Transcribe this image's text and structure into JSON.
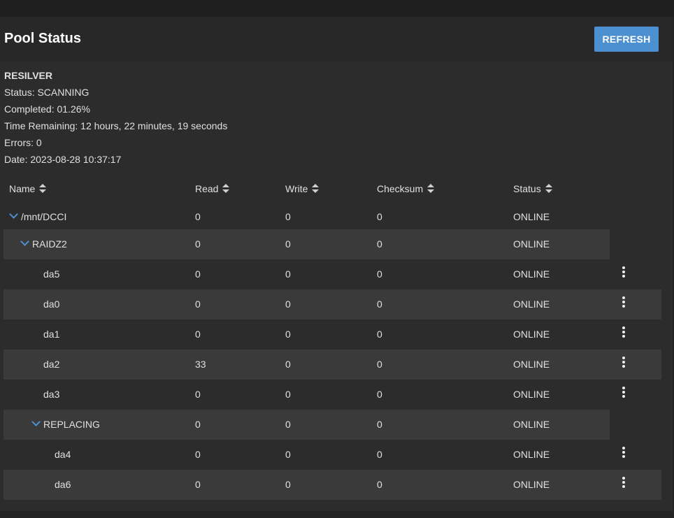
{
  "header": {
    "title": "Pool Status",
    "refresh_label": "REFRESH"
  },
  "resilver": {
    "heading": "RESILVER",
    "status": "Status: SCANNING",
    "completed": "Completed: 01.26%",
    "time_remaining": "Time Remaining: 12 hours, 22 minutes, 19 seconds",
    "errors": "Errors: 0",
    "date": "Date: 2023-08-28 10:37:17"
  },
  "table": {
    "columns": [
      "Name",
      "Read",
      "Write",
      "Checksum",
      "Status"
    ],
    "rows": [
      {
        "name": "/mnt/DCCI",
        "read": "0",
        "write": "0",
        "checksum": "0",
        "status": "ONLINE"
      },
      {
        "name": "RAIDZ2",
        "read": "0",
        "write": "0",
        "checksum": "0",
        "status": "ONLINE"
      },
      {
        "name": "da5",
        "read": "0",
        "write": "0",
        "checksum": "0",
        "status": "ONLINE"
      },
      {
        "name": "da0",
        "read": "0",
        "write": "0",
        "checksum": "0",
        "status": "ONLINE"
      },
      {
        "name": "da1",
        "read": "0",
        "write": "0",
        "checksum": "0",
        "status": "ONLINE"
      },
      {
        "name": "da2",
        "read": "33",
        "write": "0",
        "checksum": "0",
        "status": "ONLINE"
      },
      {
        "name": "da3",
        "read": "0",
        "write": "0",
        "checksum": "0",
        "status": "ONLINE"
      },
      {
        "name": "REPLACING",
        "read": "0",
        "write": "0",
        "checksum": "0",
        "status": "ONLINE"
      },
      {
        "name": "da4",
        "read": "0",
        "write": "0",
        "checksum": "0",
        "status": "ONLINE"
      },
      {
        "name": "da6",
        "read": "0",
        "write": "0",
        "checksum": "0",
        "status": "ONLINE"
      }
    ]
  },
  "colors": {
    "accent": "#4d90d1",
    "row_alt": "#3a3a3a",
    "card": "#2c2c2c"
  }
}
